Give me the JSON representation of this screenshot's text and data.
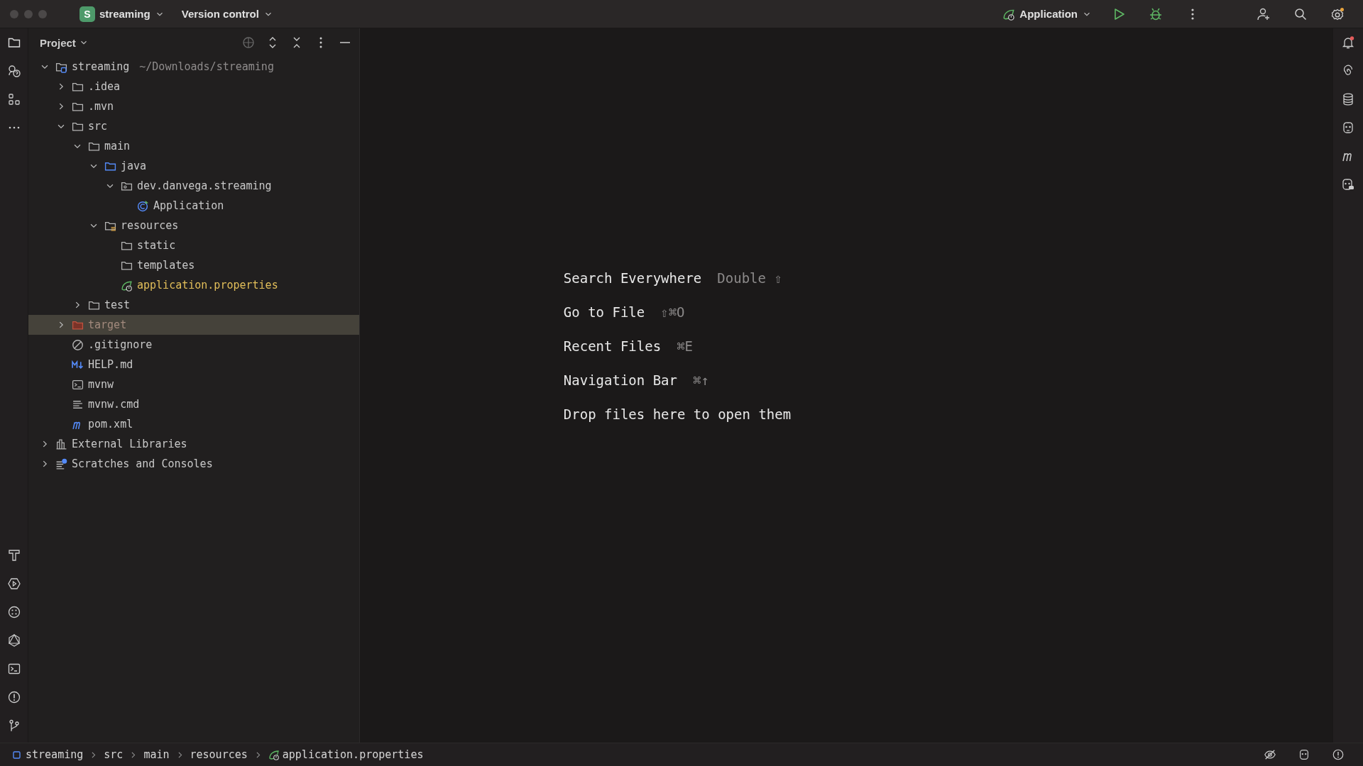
{
  "title_bar": {
    "project_badge": "S",
    "project": "streaming",
    "vcs": "Version control",
    "run_config": "Application"
  },
  "project_panel": {
    "title": "Project"
  },
  "tree": [
    {
      "label": "streaming",
      "note": "~/Downloads/streaming",
      "kind": "module",
      "expanded": true,
      "selected": false,
      "children": [
        {
          "label": ".idea",
          "kind": "folder",
          "expanded": false,
          "selected": false
        },
        {
          "label": ".mvn",
          "kind": "folder",
          "expanded": false,
          "selected": false
        },
        {
          "label": "src",
          "kind": "folder",
          "expanded": true,
          "selected": false,
          "children": [
            {
              "label": "main",
              "kind": "folder",
              "expanded": true,
              "selected": false,
              "children": [
                {
                  "label": "java",
                  "kind": "source",
                  "expanded": true,
                  "selected": false,
                  "children": [
                    {
                      "label": "dev.danvega.streaming",
                      "kind": "package",
                      "expanded": true,
                      "selected": false,
                      "children": [
                        {
                          "label": "Application",
                          "kind": "class",
                          "selected": false
                        }
                      ]
                    }
                  ]
                },
                {
                  "label": "resources",
                  "kind": "resources",
                  "expanded": true,
                  "selected": false,
                  "children": [
                    {
                      "label": "static",
                      "kind": "folder",
                      "selected": false
                    },
                    {
                      "label": "templates",
                      "kind": "folder",
                      "selected": false
                    },
                    {
                      "label": "application.properties",
                      "kind": "properties",
                      "selected": false
                    }
                  ]
                }
              ]
            },
            {
              "label": "test",
              "kind": "folder",
              "expanded": false,
              "selected": false
            }
          ]
        },
        {
          "label": "target",
          "kind": "excluded",
          "expanded": false,
          "selected": true
        },
        {
          "label": ".gitignore",
          "kind": "ignore",
          "selected": false
        },
        {
          "label": "HELP.md",
          "kind": "markdown",
          "selected": false
        },
        {
          "label": "mvnw",
          "kind": "script",
          "selected": false
        },
        {
          "label": "mvnw.cmd",
          "kind": "text",
          "selected": false
        },
        {
          "label": "pom.xml",
          "kind": "maven",
          "selected": false
        }
      ]
    },
    {
      "label": "External Libraries",
      "kind": "libraries",
      "expanded": false,
      "selected": false
    },
    {
      "label": "Scratches and Consoles",
      "kind": "scratches",
      "expanded": false,
      "selected": false
    }
  ],
  "editor_hints": [
    {
      "label": "Search Everywhere",
      "shortcut": "Double ⇧"
    },
    {
      "label": "Go to File",
      "shortcut": "⇧⌘O"
    },
    {
      "label": "Recent Files",
      "shortcut": "⌘E"
    },
    {
      "label": "Navigation Bar",
      "shortcut": "⌘↑"
    },
    {
      "label": "Drop files here to open them"
    }
  ],
  "breadcrumbs": [
    {
      "label": "streaming",
      "kind": "module"
    },
    {
      "label": "src",
      "kind": "plain"
    },
    {
      "label": "main",
      "kind": "plain"
    },
    {
      "label": "resources",
      "kind": "plain"
    },
    {
      "label": "application.properties",
      "kind": "properties"
    }
  ]
}
